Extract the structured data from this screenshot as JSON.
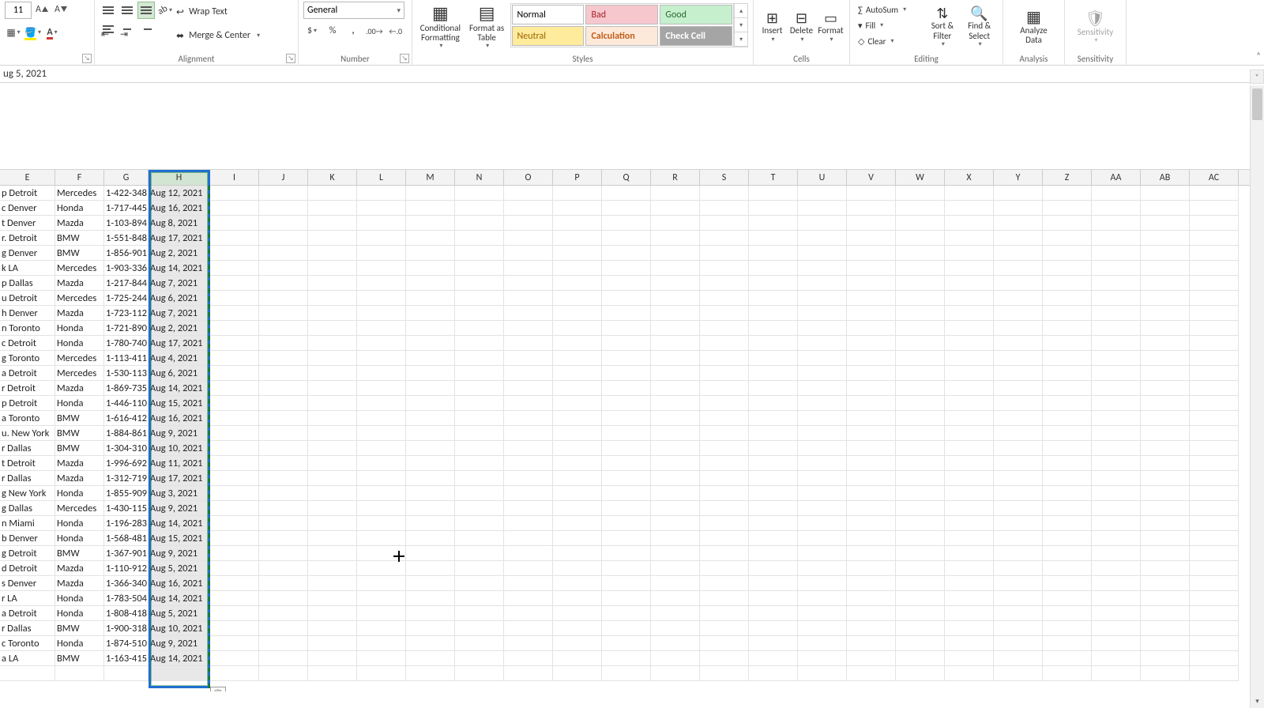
{
  "ribbon": {
    "font_size": "11",
    "wrap_text": "Wrap Text",
    "merge_center": "Merge & Center",
    "number_format": "General",
    "cond_fmt_l1": "Conditional",
    "cond_fmt_l2": "Formatting",
    "fmt_table_l1": "Format as",
    "fmt_table_l2": "Table",
    "style_normal": "Normal",
    "style_bad": "Bad",
    "style_good": "Good",
    "style_neutral": "Neutral",
    "style_calc": "Calculation",
    "style_check": "Check Cell",
    "insert": "Insert",
    "delete": "Delete",
    "format": "Format",
    "autosum": "AutoSum",
    "fill": "Fill",
    "clear": "Clear",
    "sort_filter_l1": "Sort &",
    "sort_filter_l2": "Filter",
    "find_select_l1": "Find &",
    "find_select_l2": "Select",
    "analyze_l1": "Analyze",
    "analyze_l2": "Data",
    "sensitivity": "Sensitivity",
    "grp_alignment": "Alignment",
    "grp_number": "Number",
    "grp_styles": "Styles",
    "grp_cells": "Cells",
    "grp_editing": "Editing",
    "grp_analysis": "Analysis",
    "grp_sensitivity": "Sensitivity"
  },
  "formula_bar": "ug 5, 2021",
  "columns": [
    "E",
    "F",
    "G",
    "H",
    "I",
    "J",
    "K",
    "L",
    "M",
    "N",
    "O",
    "P",
    "Q",
    "R",
    "S",
    "T",
    "U",
    "V",
    "W",
    "X",
    "Y",
    "Z",
    "AA",
    "AB",
    "AC"
  ],
  "selected_column": "H",
  "rows": [
    {
      "e": "p Detroit",
      "f": "Mercedes",
      "g": "1-422-348",
      "h": "Aug 12, 2021"
    },
    {
      "e": "c Denver",
      "f": "Honda",
      "g": "1-717-445",
      "h": "Aug 16, 2021"
    },
    {
      "e": "t Denver",
      "f": "Mazda",
      "g": "1-103-894",
      "h": "Aug 8, 2021"
    },
    {
      "e": "r. Detroit",
      "f": "BMW",
      "g": "1-551-848",
      "h": "Aug 17, 2021"
    },
    {
      "e": "g Denver",
      "f": "BMW",
      "g": "1-856-901",
      "h": "Aug 2, 2021"
    },
    {
      "e": "k LA",
      "f": "Mercedes",
      "g": "1-903-336",
      "h": "Aug 14, 2021"
    },
    {
      "e": "p Dallas",
      "f": "Mazda",
      "g": "1-217-844",
      "h": "Aug 7, 2021"
    },
    {
      "e": "u Detroit",
      "f": "Mercedes",
      "g": "1-725-244",
      "h": "Aug 6, 2021"
    },
    {
      "e": "h Denver",
      "f": "Mazda",
      "g": "1-723-112",
      "h": "Aug 7, 2021"
    },
    {
      "e": "n Toronto",
      "f": "Honda",
      "g": "1-721-890",
      "h": "Aug 2, 2021"
    },
    {
      "e": "c Detroit",
      "f": "Honda",
      "g": "1-780-740",
      "h": "Aug 17, 2021"
    },
    {
      "e": "g Toronto",
      "f": "Mercedes",
      "g": "1-113-411",
      "h": "Aug 4, 2021"
    },
    {
      "e": "a Detroit",
      "f": "Mercedes",
      "g": "1-530-113",
      "h": "Aug 6, 2021"
    },
    {
      "e": "r Detroit",
      "f": "Mazda",
      "g": "1-869-735",
      "h": "Aug 14, 2021"
    },
    {
      "e": "p Detroit",
      "f": "Honda",
      "g": "1-446-110",
      "h": "Aug 15, 2021"
    },
    {
      "e": "a Toronto",
      "f": "BMW",
      "g": "1-616-412",
      "h": "Aug 16, 2021"
    },
    {
      "e": "u. New York",
      "f": "BMW",
      "g": "1-884-861",
      "h": "Aug 9, 2021"
    },
    {
      "e": "r Dallas",
      "f": "BMW",
      "g": "1-304-310",
      "h": "Aug 10, 2021"
    },
    {
      "e": "t Detroit",
      "f": "Mazda",
      "g": "1-996-692",
      "h": "Aug 11, 2021"
    },
    {
      "e": "r Dallas",
      "f": "Mazda",
      "g": "1-312-719",
      "h": "Aug 17, 2021"
    },
    {
      "e": "g New York",
      "f": "Honda",
      "g": "1-855-909",
      "h": "Aug 3, 2021"
    },
    {
      "e": "g Dallas",
      "f": "Mercedes",
      "g": "1-430-115",
      "h": "Aug 9, 2021"
    },
    {
      "e": "n Miami",
      "f": "Honda",
      "g": "1-196-283",
      "h": "Aug 14, 2021"
    },
    {
      "e": "b Denver",
      "f": "Honda",
      "g": "1-568-481",
      "h": "Aug 15, 2021"
    },
    {
      "e": "g Detroit",
      "f": "BMW",
      "g": "1-367-901",
      "h": "Aug 9, 2021"
    },
    {
      "e": "d Detroit",
      "f": "Mazda",
      "g": "1-110-912",
      "h": "Aug 5, 2021"
    },
    {
      "e": "s Denver",
      "f": "Mazda",
      "g": "1-366-340",
      "h": "Aug 16, 2021"
    },
    {
      "e": "r LA",
      "f": "Honda",
      "g": "1-783-504",
      "h": "Aug 14, 2021"
    },
    {
      "e": "a Detroit",
      "f": "Honda",
      "g": "1-808-418",
      "h": "Aug 5, 2021"
    },
    {
      "e": "r Dallas",
      "f": "BMW",
      "g": "1-900-318",
      "h": "Aug 10, 2021"
    },
    {
      "e": "c Toronto",
      "f": "Honda",
      "g": "1-874-510",
      "h": "Aug 9, 2021"
    },
    {
      "e": "a LA",
      "f": "BMW",
      "g": "1-163-415",
      "h": "Aug 14, 2021"
    }
  ],
  "colors": {
    "bad_bg": "#f7c7ce",
    "bad_fg": "#a4262c",
    "good_bg": "#c6efce",
    "good_fg": "#2d6a2e",
    "neutral_bg": "#ffeb9c",
    "neutral_fg": "#9c6500",
    "calc_bg": "#fde9d9",
    "calc_fg": "#bf5d19",
    "check_bg": "#a5a5a5",
    "check_fg": "#ffffff",
    "highlight": "#1f6fd0"
  }
}
